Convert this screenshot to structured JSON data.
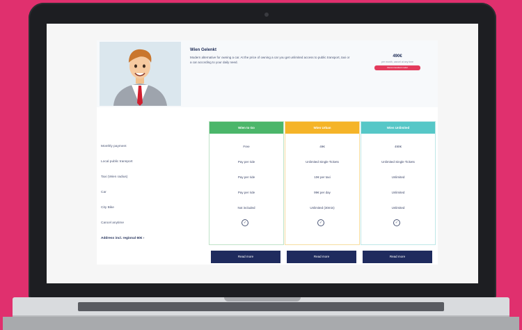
{
  "profile": {
    "title": "Wien Gelenkt",
    "description": "Modern alternative for owning a car. At the price of owning a car you get unlimited access to public transport, taxi or a car according to your daily need.",
    "price": "490€",
    "price_note": "per month, cancel at any time",
    "cta_label": "Recommended model"
  },
  "features": [
    "Monthly payment",
    "Local public transport",
    "Taxi (Wien radius)",
    "Car",
    "City Bike",
    "Cancel anytime",
    "Address incl. regional 60€"
  ],
  "plans": [
    {
      "name": "Wien to Go",
      "color": "#4bb66a",
      "border": "#bfe3c8",
      "values": [
        "Free",
        "Pay per ride",
        "Pay per ride",
        "Pay per ride",
        "Not included"
      ],
      "button": "Read more"
    },
    {
      "name": "Wien Urban",
      "color": "#f5b428",
      "border": "#f6dda0",
      "values": [
        "49€",
        "Unlimited Single Tickets",
        "10€ per taxi",
        "99€ per day",
        "Unlimited (30min)"
      ],
      "button": "Read more"
    },
    {
      "name": "Wien Unlimited",
      "color": "#56c7c7",
      "border": "#bde7e7",
      "values": [
        "490€",
        "Unlimited Single Tickets",
        "Unlimited",
        "Unlimited",
        "Unlimited"
      ],
      "button": "Read more"
    }
  ],
  "check_symbol": "✓",
  "arrow_symbol": "›"
}
